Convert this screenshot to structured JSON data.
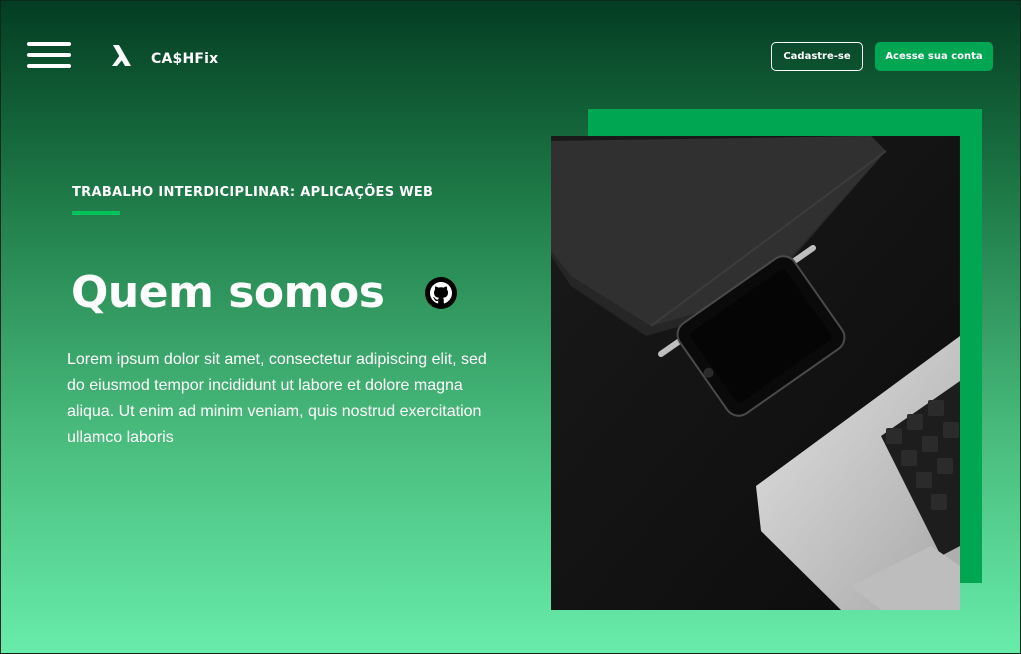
{
  "header": {
    "menu_icon": "hamburger-menu-icon",
    "logo_icon": "cashfix-logo-icon",
    "brand": "CA$HFix",
    "signup_label": "Cadastre-se",
    "login_label": "Acesse sua conta"
  },
  "hero": {
    "eyebrow": "TRABALHO INTERDICIPLINAR: APLICAÇÕES WEB",
    "title": "Quem somos",
    "github_icon": "github-icon",
    "text": "Lorem ipsum dolor sit amet, consectetur adipiscing elit, sed do eiusmod tempor incididunt ut labore et dolore magna aliqua. Ut enim ad minim veniam, quis nostrud exercitation ullamco laboris"
  },
  "colors": {
    "accent": "#00a651",
    "gradient_top": "#033d22",
    "gradient_bottom": "#68ecaa",
    "text": "#ffffff"
  }
}
